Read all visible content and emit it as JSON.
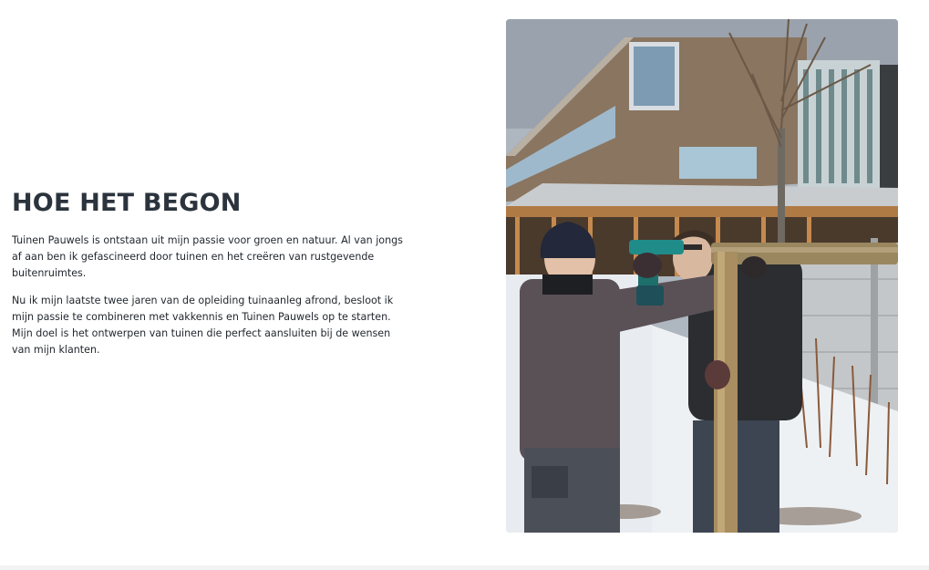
{
  "section": {
    "heading": "HOE HET BEGON",
    "paragraph_1": "Tuinen Pauwels is ontstaan uit mijn passie voor groen en natuur. Al van jongs af aan ben ik gefascineerd door tuinen en het creëren van rustgevende buitenruimtes.",
    "paragraph_2": "Nu ik mijn laatste twee jaren van de opleiding tuinaanleg afrond, besloot ik mijn passie te combineren met vakkennis en Tuinen Pauwels op te starten. Mijn doel is het ontwerpen van tuinen die perfect aansluiten bij de wensen van mijn klanten."
  },
  "colors": {
    "heading": "#2b333d",
    "body_text": "#1f252c",
    "background": "#ffffff",
    "bottom_band": "#f2f3f5"
  }
}
